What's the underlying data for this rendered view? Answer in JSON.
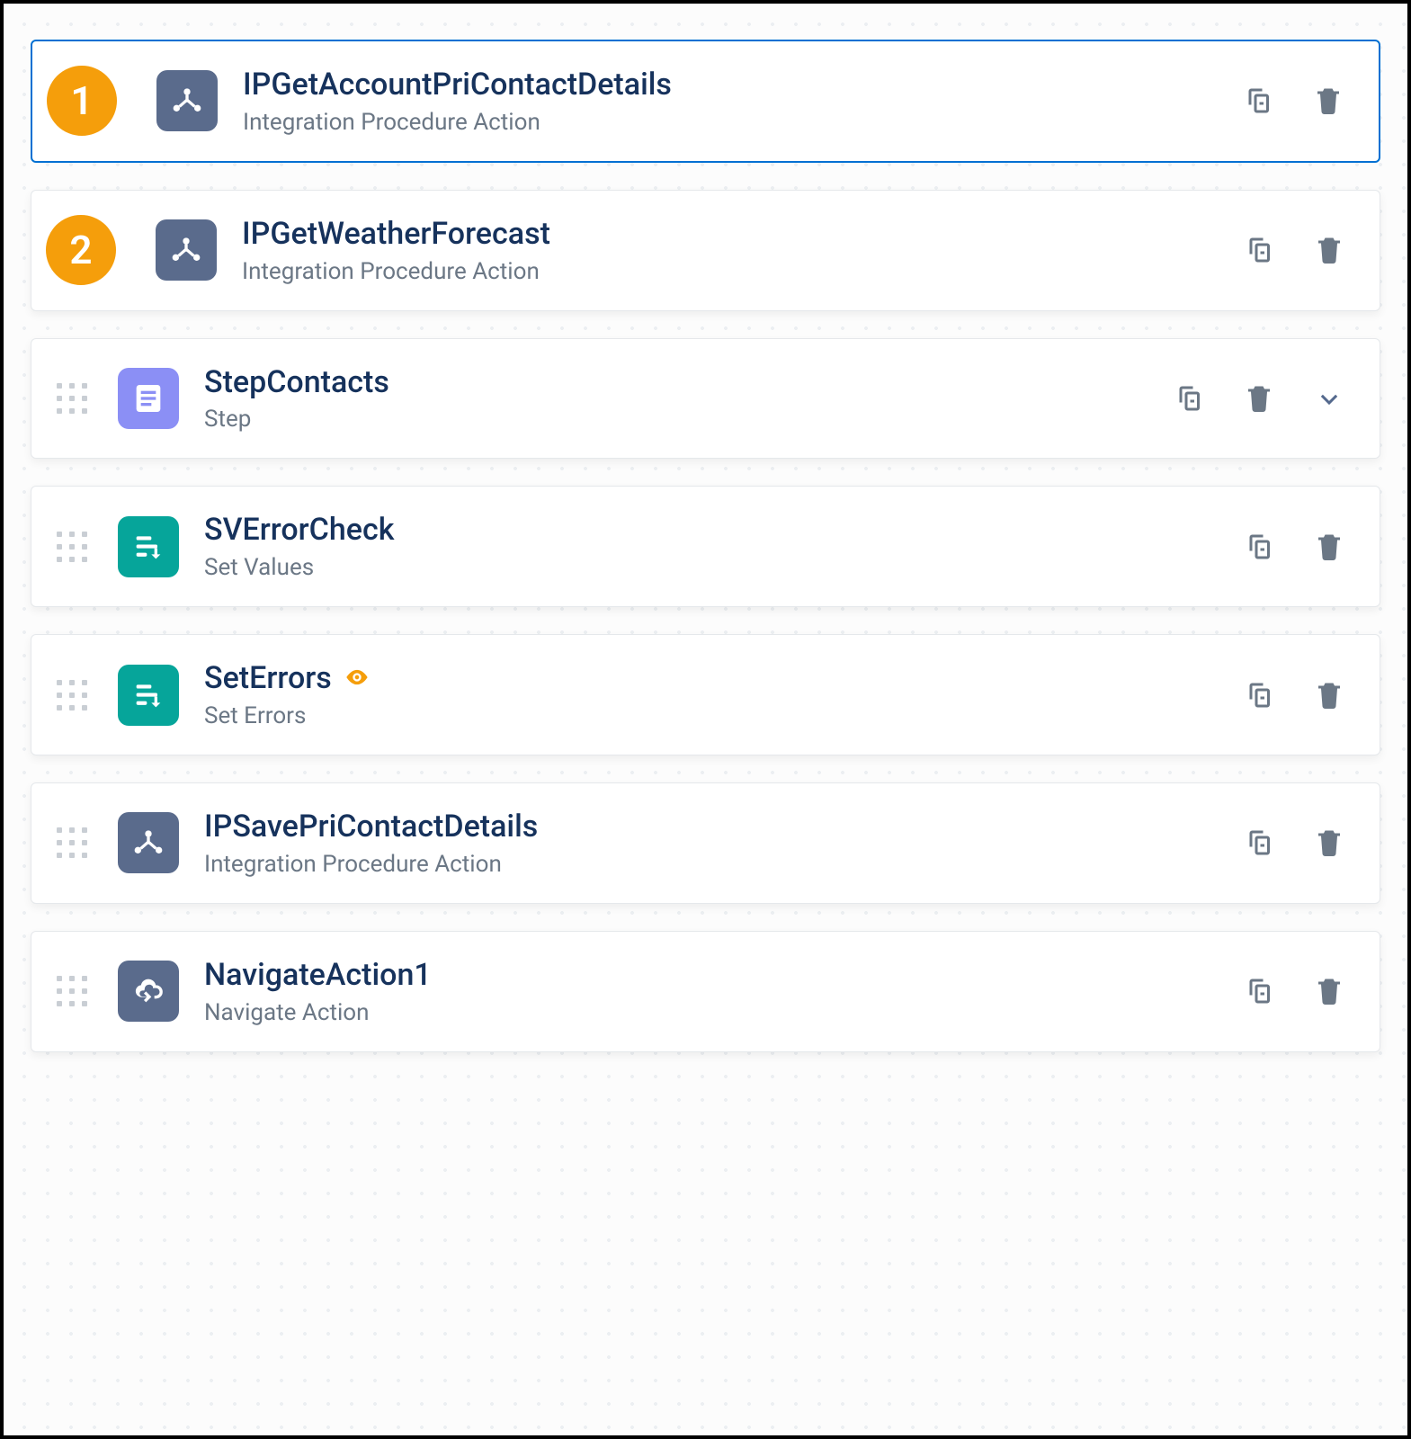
{
  "items": [
    {
      "badge": "1",
      "title": "IPGetAccountPriContactDetails",
      "subtitle": "Integration Procedure Action",
      "iconType": "integration",
      "selected": true,
      "hasDrag": false,
      "hasEye": false,
      "hasExpand": false
    },
    {
      "badge": "2",
      "title": "IPGetWeatherForecast",
      "subtitle": "Integration Procedure Action",
      "iconType": "integration",
      "selected": false,
      "hasDrag": false,
      "hasEye": false,
      "hasExpand": false
    },
    {
      "badge": null,
      "title": "StepContacts",
      "subtitle": "Step",
      "iconType": "step",
      "selected": false,
      "hasDrag": true,
      "hasEye": false,
      "hasExpand": true
    },
    {
      "badge": null,
      "title": "SVErrorCheck",
      "subtitle": "Set Values",
      "iconType": "setvalues",
      "selected": false,
      "hasDrag": true,
      "hasEye": false,
      "hasExpand": false
    },
    {
      "badge": null,
      "title": "SetErrors",
      "subtitle": "Set Errors",
      "iconType": "setvalues",
      "selected": false,
      "hasDrag": true,
      "hasEye": true,
      "hasExpand": false
    },
    {
      "badge": null,
      "title": "IPSavePriContactDetails",
      "subtitle": "Integration Procedure Action",
      "iconType": "integration",
      "selected": false,
      "hasDrag": true,
      "hasEye": false,
      "hasExpand": false
    },
    {
      "badge": null,
      "title": "NavigateAction1",
      "subtitle": "Navigate Action",
      "iconType": "navigate",
      "selected": false,
      "hasDrag": true,
      "hasEye": false,
      "hasExpand": false
    }
  ]
}
